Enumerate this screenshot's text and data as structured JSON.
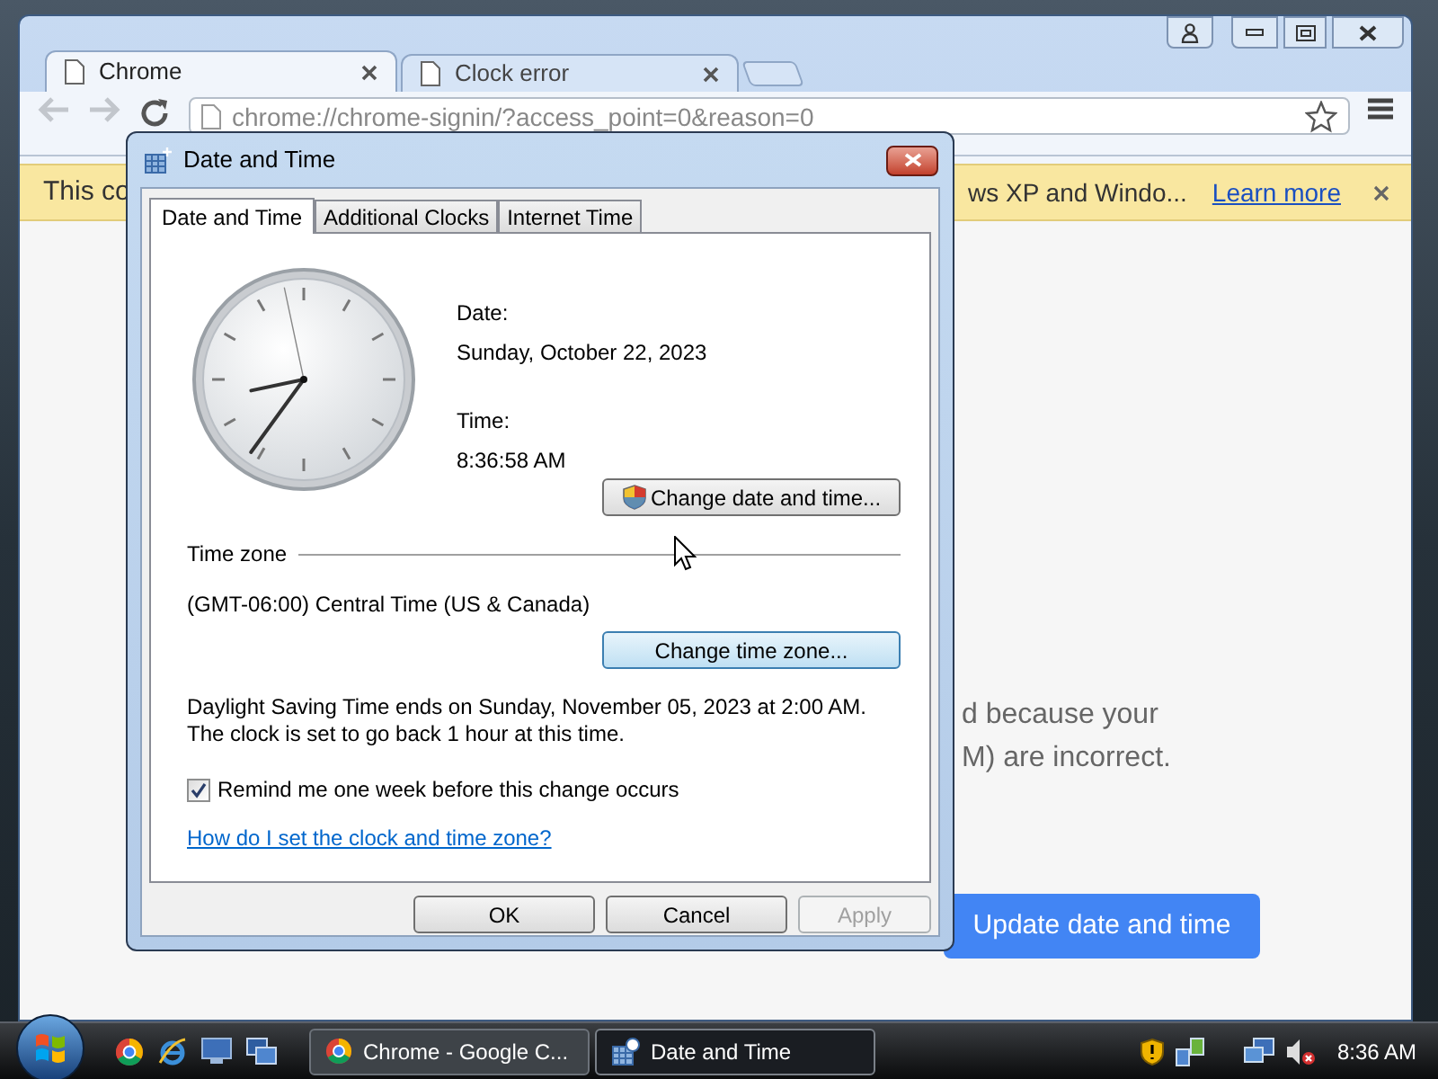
{
  "browser": {
    "tabs": [
      {
        "label": "Chrome",
        "selected": true
      },
      {
        "label": "Clock error",
        "selected": false
      }
    ],
    "url": "chrome://chrome-signin/?access_point=0&reason=0",
    "infobar": {
      "text_left": "This co",
      "text_right": "ws XP and Windo...",
      "link": "Learn more"
    },
    "page": {
      "line_1": "d because your",
      "line_2": "M) are incorrect.",
      "button": "Update date and time"
    }
  },
  "dialog": {
    "title": "Date and Time",
    "tabs": [
      {
        "label": "Date and Time",
        "selected": true
      },
      {
        "label": "Additional Clocks",
        "selected": false
      },
      {
        "label": "Internet Time",
        "selected": false
      }
    ],
    "date_label": "Date:",
    "date": "Sunday, October 22, 2023",
    "time_label": "Time:",
    "time": "8:36:58 AM",
    "change_datetime_button": "Change date and time...",
    "timezone_heading": "Time zone",
    "timezone": "(GMT-06:00) Central Time (US & Canada)",
    "change_timezone_button": "Change time zone...",
    "dst_note": "Daylight Saving Time ends on Sunday, November 05, 2023 at 2:00 AM. The clock is set to go back 1 hour at this time.",
    "reminder": {
      "label": "Remind me one week before this change occurs",
      "checked": true
    },
    "help_link": "How do I set the clock and time zone?",
    "buttons": [
      {
        "label": "OK",
        "disabled": false
      },
      {
        "label": "Cancel",
        "disabled": false
      },
      {
        "label": "Apply",
        "disabled": true
      }
    ]
  },
  "taskbar": {
    "tasks": [
      {
        "label": "Chrome - Google C...",
        "selected": false
      },
      {
        "label": "Date and Time",
        "selected": true
      }
    ],
    "clock": "8:36 AM"
  }
}
